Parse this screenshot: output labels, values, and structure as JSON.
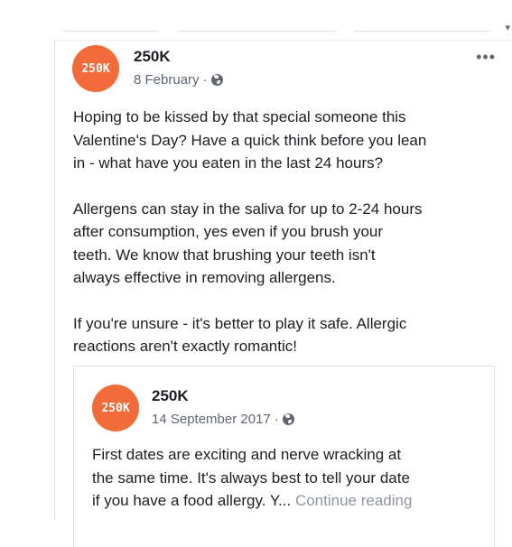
{
  "post": {
    "logo_text": "250K",
    "page_name": "250K",
    "date": "8 February",
    "separator": "·",
    "privacy_icon": "globe-icon",
    "more_icon": "more-options-icon",
    "more_glyph": "•••",
    "paragraphs": [
      "Hoping to be kissed by that special someone this\nValentine's Day? Have a quick think before you lean\nin - what have you eaten in the last 24 hours?",
      "Allergens can stay in the saliva for up to 2-24 hours\nafter consumption, yes even if you brush your\nteeth. We know that brushing your teeth isn't\nalways effective in removing allergens.",
      "If you're unsure - it's better to play it safe. Allergic\nreactions aren't exactly romantic!"
    ]
  },
  "shared_post": {
    "logo_text": "250K",
    "page_name": "250K",
    "date": "14 September 2017",
    "separator": "·",
    "privacy_icon": "globe-icon",
    "text": "First dates are exciting and nerve wracking at\nthe same time. It's always best to tell your date\nif you have a food allergy. Y...",
    "continue_label": "Continue reading"
  },
  "colors": {
    "brand_orange": "#f26b3a",
    "meta_gray": "#606770",
    "link_gray": "#90949c"
  }
}
